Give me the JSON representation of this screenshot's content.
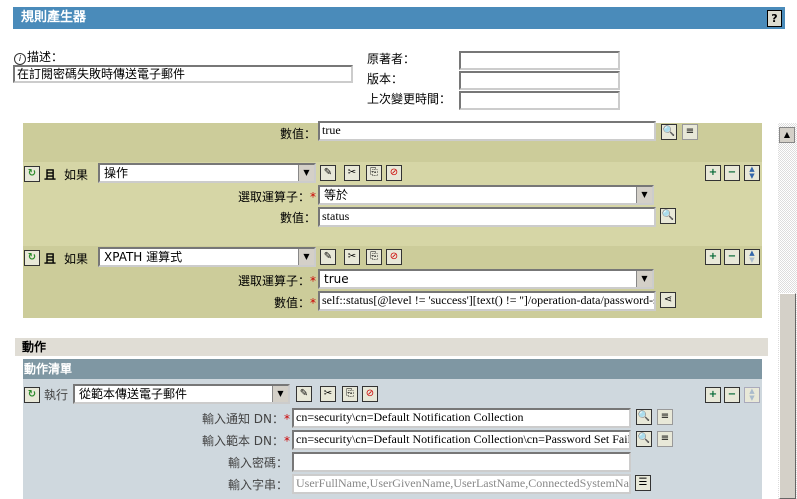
{
  "header": {
    "title": "規則產生器",
    "help_icon": "?"
  },
  "meta": {
    "description_label": "描述：",
    "description_value": "在訂閱密碼失敗時傳送電子郵件",
    "author_label": "原著者：",
    "version_label": "版本：",
    "last_modified_label": "上次變更時間：",
    "author_value": "",
    "version_value": "",
    "last_modified_value": ""
  },
  "conditions": [
    {
      "value_label": "數值：",
      "value": "true"
    },
    {
      "and_label": "且",
      "if_label": "如果",
      "type": "操作",
      "operator_label": "選取運算子：",
      "operator": "等於",
      "value_label": "數值：",
      "value": "status"
    },
    {
      "and_label": "且",
      "if_label": "如果",
      "type": "XPATH 運算式",
      "operator_label": "選取運算子：",
      "operator": "true",
      "value_label": "數值：",
      "value": "self::status[@level != 'success'][text() != '']/operation-data/password-su"
    }
  ],
  "actions": {
    "section_label": "動作",
    "list_label": "動作清單",
    "do_label": "執行",
    "action": "從範本傳送電子郵件",
    "fields": [
      {
        "label": "輸入通知 DN：",
        "required": true,
        "value": "cn=security\\cn=Default Notification Collection"
      },
      {
        "label": "輸入範本 DN：",
        "required": true,
        "value": "cn=security\\cn=Default Notification Collection\\cn=Password Set Fail"
      },
      {
        "label": "輸入密碼：",
        "required": false,
        "value": ""
      },
      {
        "label": "輸入字串：",
        "required": false,
        "value": "UserFullName,UserGivenName,UserLastName,ConnectedSystemNa"
      }
    ]
  },
  "required_mark": "*"
}
